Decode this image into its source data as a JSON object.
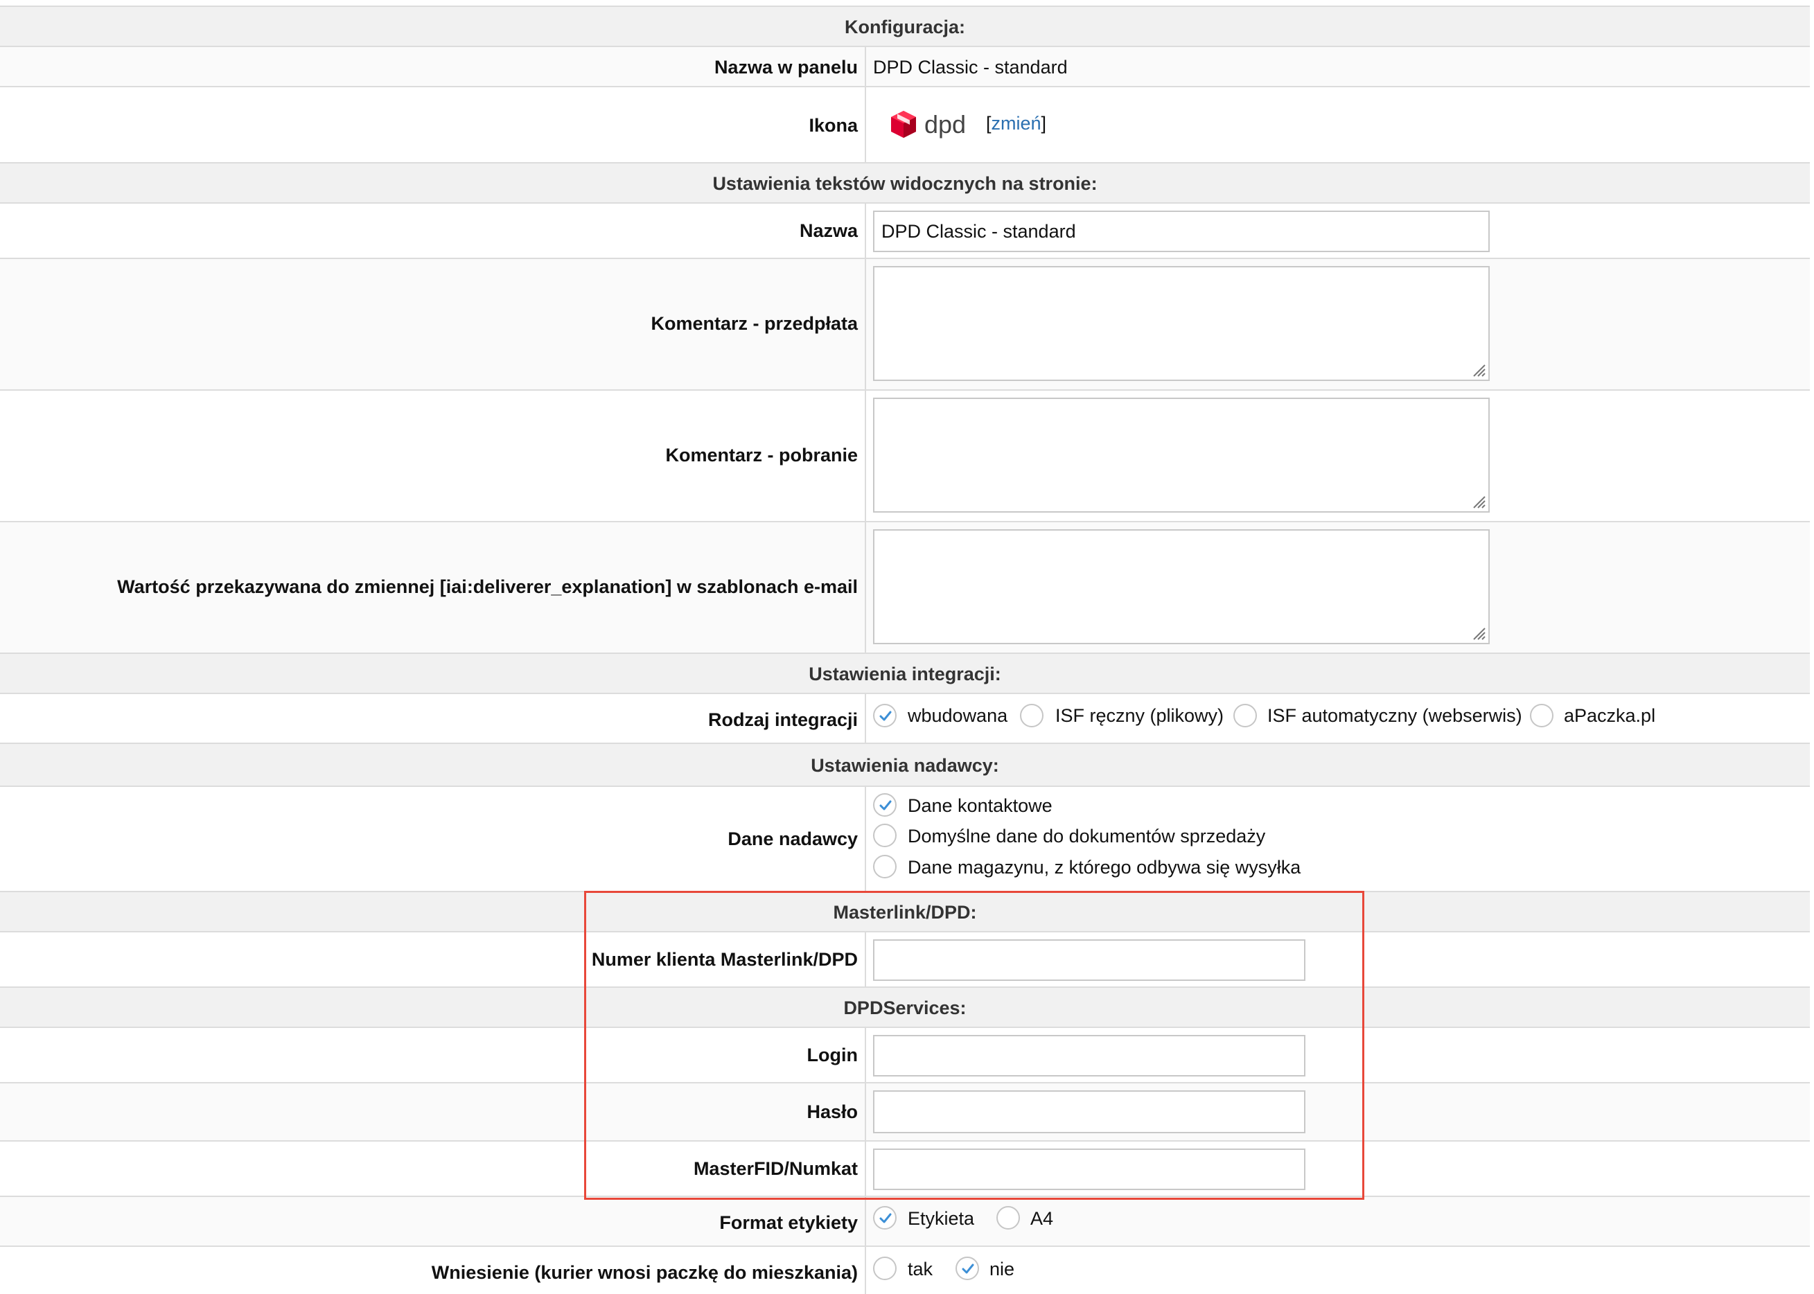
{
  "sections": {
    "config": "Konfiguracja:",
    "texts": "Ustawienia tekstów widocznych na stronie:",
    "integration": "Ustawienia integracji:",
    "sender": "Ustawienia nadawcy:",
    "masterlink": "Masterlink/DPD:",
    "dpdservices": "DPDServices:"
  },
  "fields": {
    "panel_name": {
      "label": "Nazwa w panelu",
      "value": "DPD Classic - standard"
    },
    "icon": {
      "label": "Ikona",
      "logo_text": "dpd",
      "change_open": "[",
      "change_link": "zmień",
      "change_close": "]"
    },
    "name": {
      "label": "Nazwa",
      "value": "DPD Classic - standard"
    },
    "comment_prepaid": {
      "label": "Komentarz - przedpłata",
      "value": ""
    },
    "comment_cod": {
      "label": "Komentarz - pobranie",
      "value": ""
    },
    "deliverer_explanation": {
      "label": "Wartość przekazywana do zmiennej [iai:deliverer_explanation] w szablonach e-mail",
      "value": ""
    },
    "integration_type": {
      "label": "Rodzaj integracji",
      "options": [
        "wbudowana",
        "ISF ręczny (plikowy)",
        "ISF automatyczny (webserwis)",
        "aPaczka.pl"
      ],
      "selected": "wbudowana"
    },
    "sender_data": {
      "label": "Dane nadawcy",
      "options": [
        "Dane kontaktowe",
        "Domyślne dane do dokumentów sprzedaży",
        "Dane magazynu, z którego odbywa się wysyłka"
      ],
      "selected": "Dane kontaktowe"
    },
    "client_number": {
      "label": "Numer klienta Masterlink/DPD",
      "value": ""
    },
    "login": {
      "label": "Login",
      "value": ""
    },
    "password": {
      "label": "Hasło",
      "value": ""
    },
    "masterfid": {
      "label": "MasterFID/Numkat",
      "value": ""
    },
    "label_format": {
      "label": "Format etykiety",
      "options": [
        "Etykieta",
        "A4"
      ],
      "selected": "Etykieta"
    },
    "carry_in": {
      "label": "Wniesienie (kurier wnosi paczkę do mieszkania)",
      "options": [
        "tak",
        "nie"
      ],
      "selected": "nie"
    }
  },
  "colors": {
    "highlight": "#e8483a",
    "link": "#2a6fb0",
    "check": "#3c8fd6",
    "dpd_red": "#dc0032"
  }
}
